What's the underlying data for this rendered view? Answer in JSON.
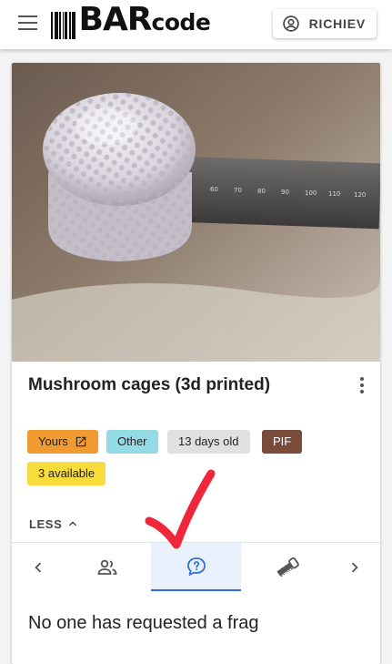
{
  "app": {
    "logo_bold": "BAR",
    "logo_rest": "code",
    "user_label": "RICHIEV"
  },
  "item": {
    "title": "Mushroom cages (3d printed)",
    "ruler_ticks": [
      "60",
      "70",
      "80",
      "90",
      "100",
      "110",
      "120"
    ]
  },
  "chips": {
    "yours": "Yours",
    "other": "Other",
    "age": "13 days old",
    "pif": "PIF",
    "available": "3 available"
  },
  "colors": {
    "yours": "#f19a30",
    "other": "#93dbe6",
    "age": "#e0e0e0",
    "pif": "#7a4c3c",
    "available": "#f8dc3c",
    "active_tab": "#2f6fd6",
    "annotation": "#f0273a"
  },
  "toggle": {
    "label": "LESS"
  },
  "tabs": {
    "items": [
      {
        "icon": "chevron-left-icon"
      },
      {
        "icon": "people-icon"
      },
      {
        "icon": "question-bubble-icon",
        "active": true
      },
      {
        "icon": "saw-icon"
      },
      {
        "icon": "chevron-right-icon"
      }
    ]
  },
  "requests": {
    "empty_message": "No one has requested a frag"
  }
}
